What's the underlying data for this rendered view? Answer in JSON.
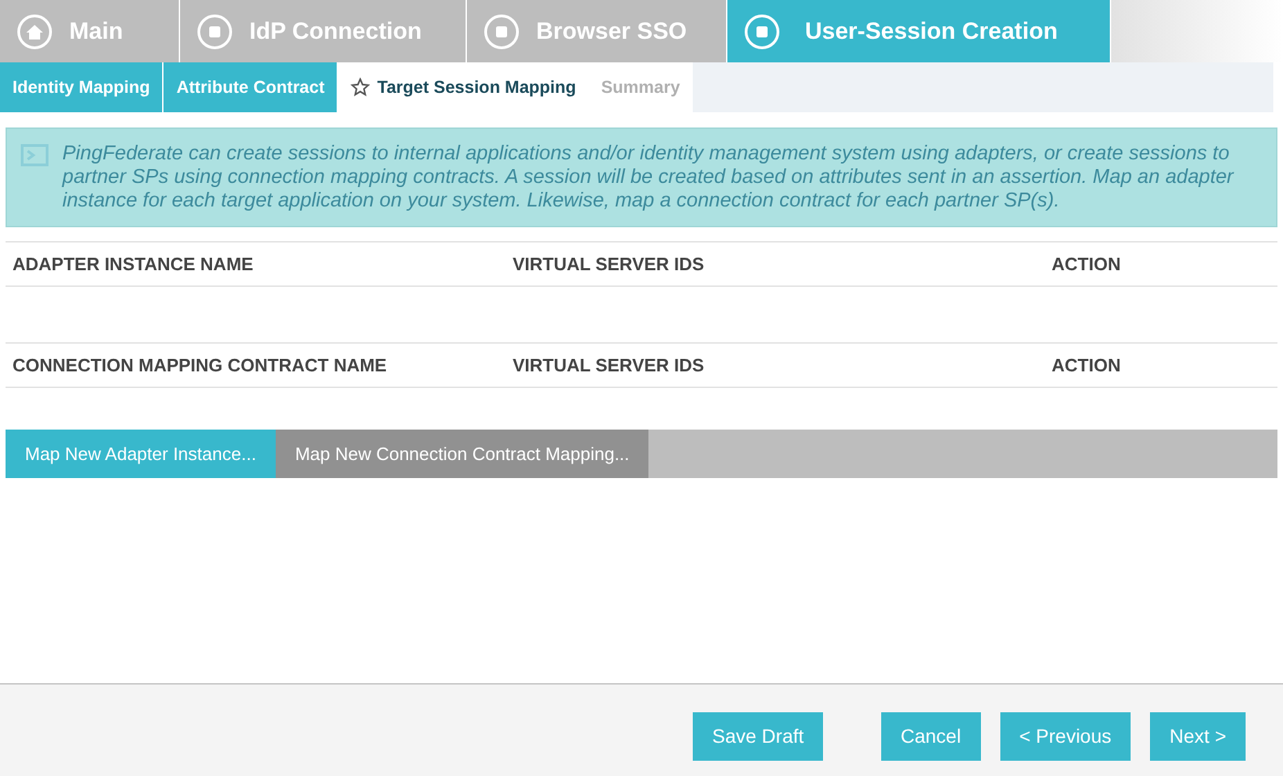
{
  "main_tabs": [
    {
      "label": "Main",
      "kind": "home",
      "selected": false
    },
    {
      "label": "IdP Connection",
      "kind": "step",
      "selected": false
    },
    {
      "label": "Browser SSO",
      "kind": "step",
      "selected": false
    },
    {
      "label": "User-Session Creation",
      "kind": "step",
      "selected": true
    }
  ],
  "sub_tabs": [
    {
      "label": "Identity Mapping",
      "selected": false,
      "done": true
    },
    {
      "label": "Attribute Contract",
      "selected": false,
      "done": true
    },
    {
      "label": "Target Session Mapping",
      "selected": true,
      "done": false
    },
    {
      "label": "Summary",
      "selected": false,
      "done": false
    }
  ],
  "info": "PingFederate can create sessions to internal applications and/or identity management system using adapters, or create sessions to partner SPs using connection mapping contracts. A session will be created based on attributes sent in an assertion. Map an adapter instance for each target application on your system. Likewise, map a connection contract for each partner SP(s).",
  "tables": [
    {
      "columns": [
        "ADAPTER INSTANCE NAME",
        "VIRTUAL SERVER IDS",
        "ACTION"
      ]
    },
    {
      "columns": [
        "CONNECTION MAPPING CONTRACT NAME",
        "VIRTUAL SERVER IDS",
        "ACTION"
      ]
    }
  ],
  "map_buttons": [
    {
      "label": "Map New Adapter Instance...",
      "kind": "primary"
    },
    {
      "label": "Map New Connection Contract Mapping...",
      "kind": "secondary"
    }
  ],
  "footer_buttons": [
    {
      "label": "Save Draft"
    },
    {
      "label": "Cancel"
    },
    {
      "label": "< Previous"
    },
    {
      "label": "Next >"
    }
  ]
}
